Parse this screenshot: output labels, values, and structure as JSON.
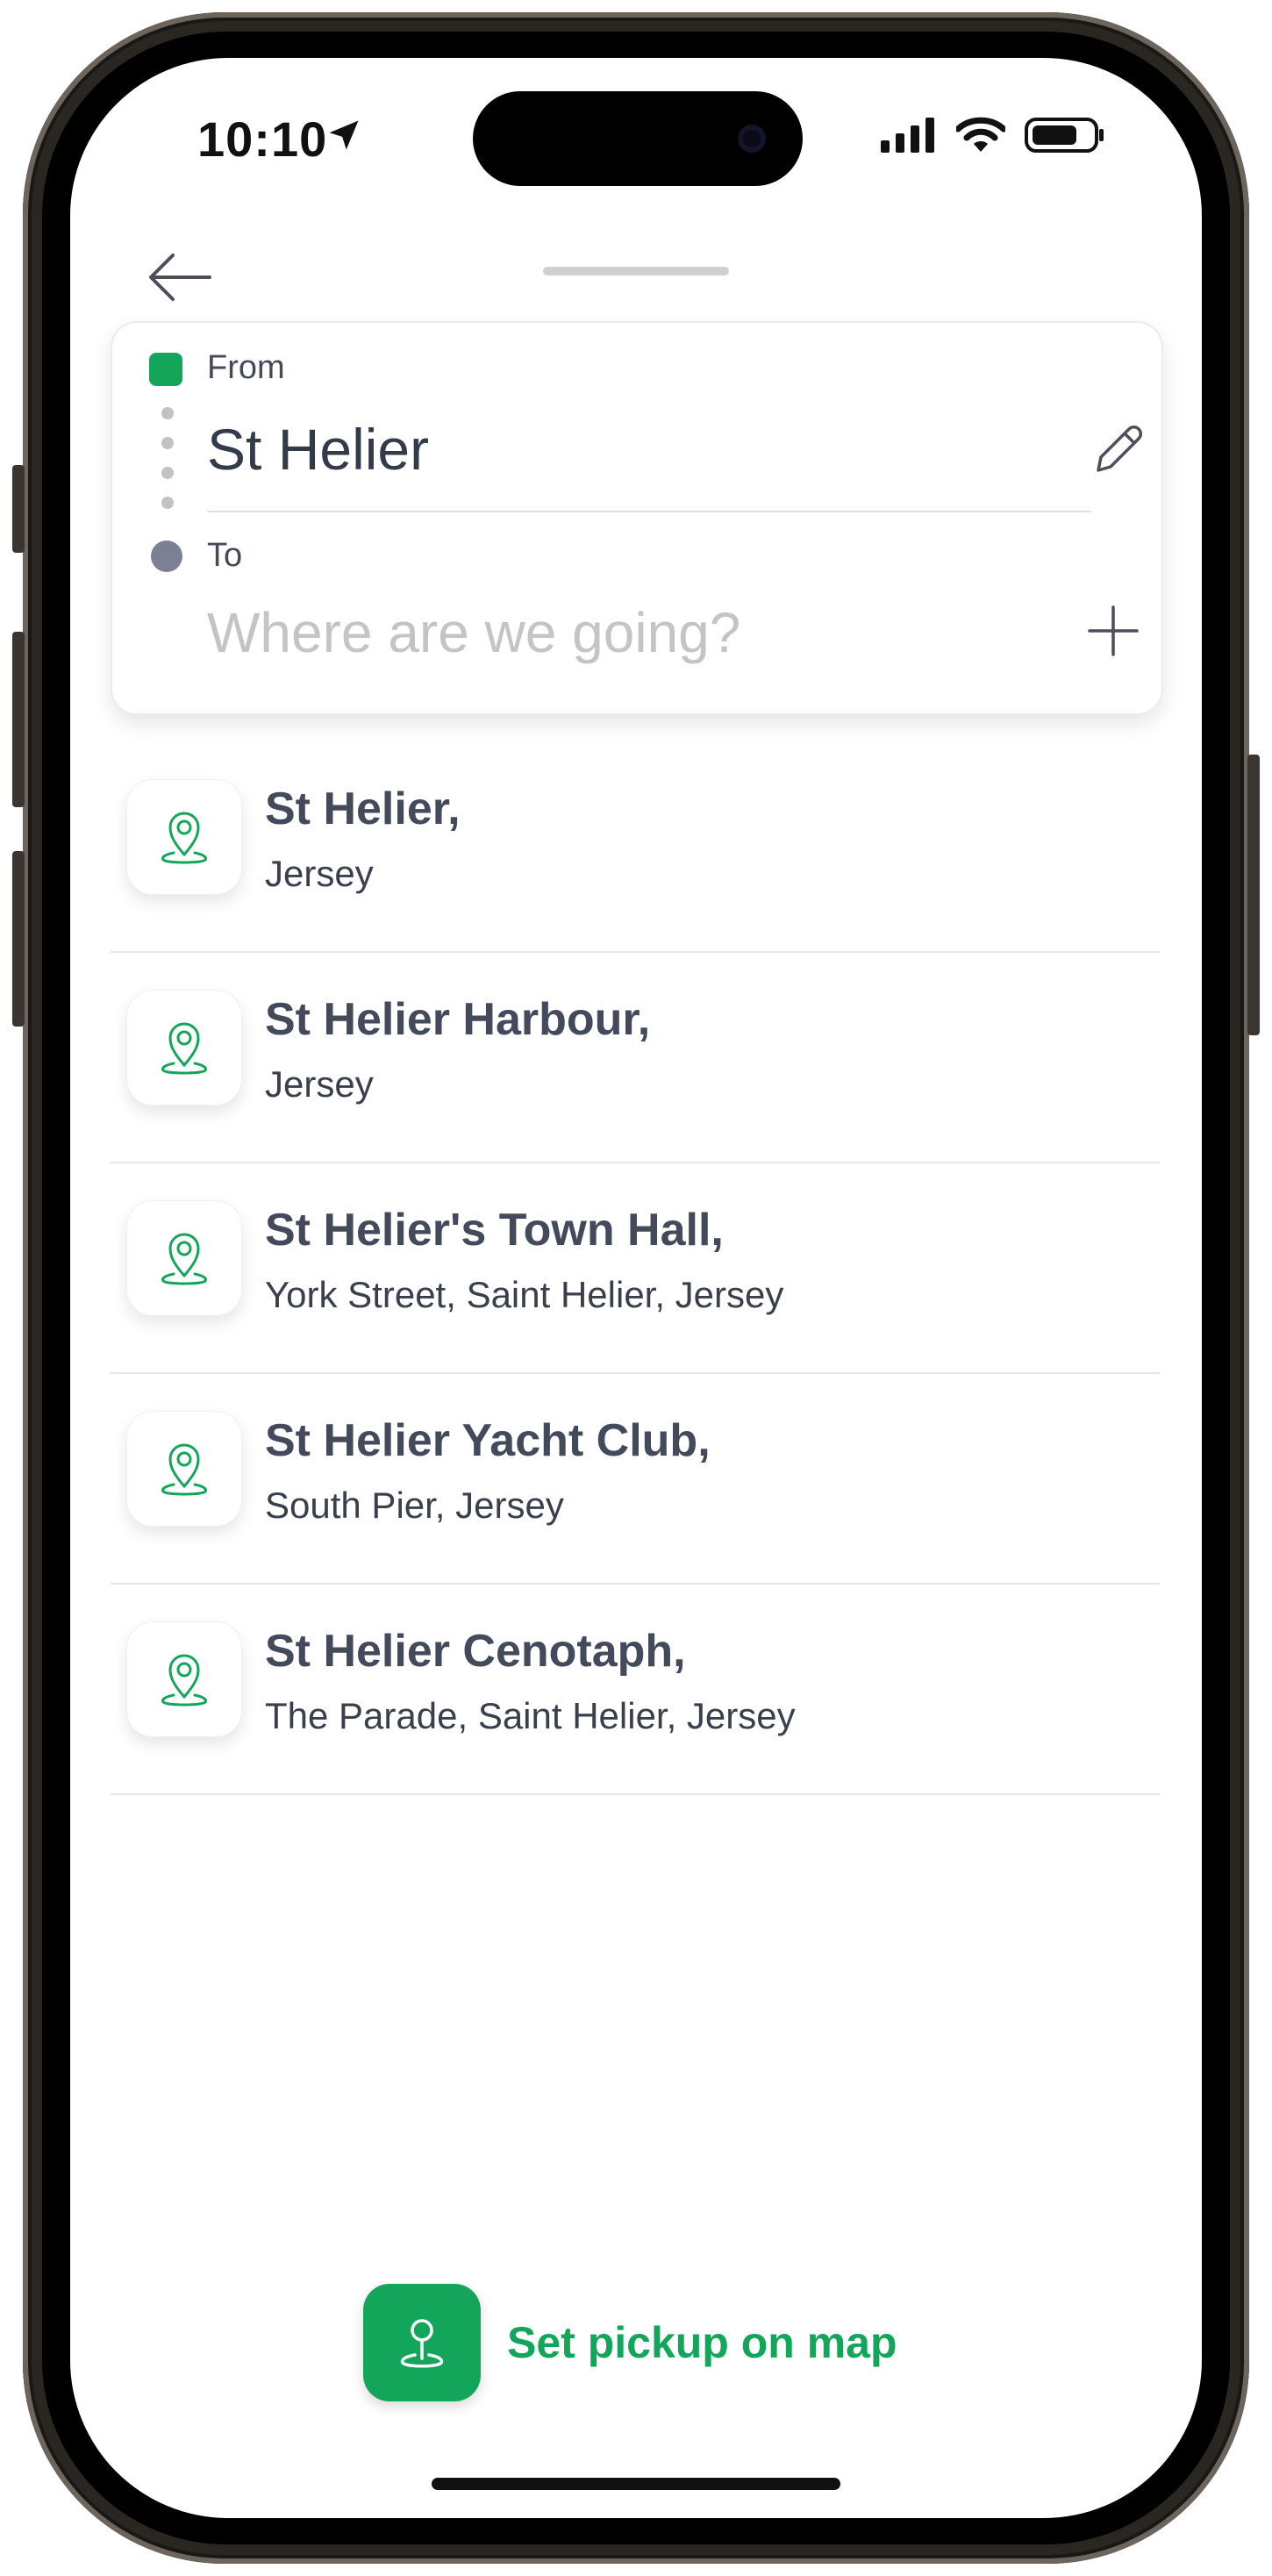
{
  "status_bar": {
    "time": "10:10"
  },
  "route": {
    "from_label": "From",
    "from_value": "St Helier",
    "to_label": "To",
    "to_placeholder": "Where are we going?",
    "to_value": ""
  },
  "results": [
    {
      "title": "St Helier,",
      "subtitle": "Jersey"
    },
    {
      "title": "St Helier Harbour,",
      "subtitle": "Jersey"
    },
    {
      "title": "St Helier's Town Hall,",
      "subtitle": "York Street, Saint Helier, Jersey"
    },
    {
      "title": "St Helier Yacht Club,",
      "subtitle": "South Pier, Jersey"
    },
    {
      "title": "St Helier Cenotaph,",
      "subtitle": "The Parade, Saint Helier, Jersey"
    }
  ],
  "pickup": {
    "label": "Set pickup on map"
  },
  "colors": {
    "accent": "#13a65b",
    "text_dark": "#434a5b",
    "to_dot": "#7b8193"
  },
  "icons": {
    "back": "arrow-left-icon",
    "edit": "pencil-icon",
    "add": "plus-icon",
    "result": "map-pin-icon",
    "pickup": "pin-on-map-icon"
  }
}
